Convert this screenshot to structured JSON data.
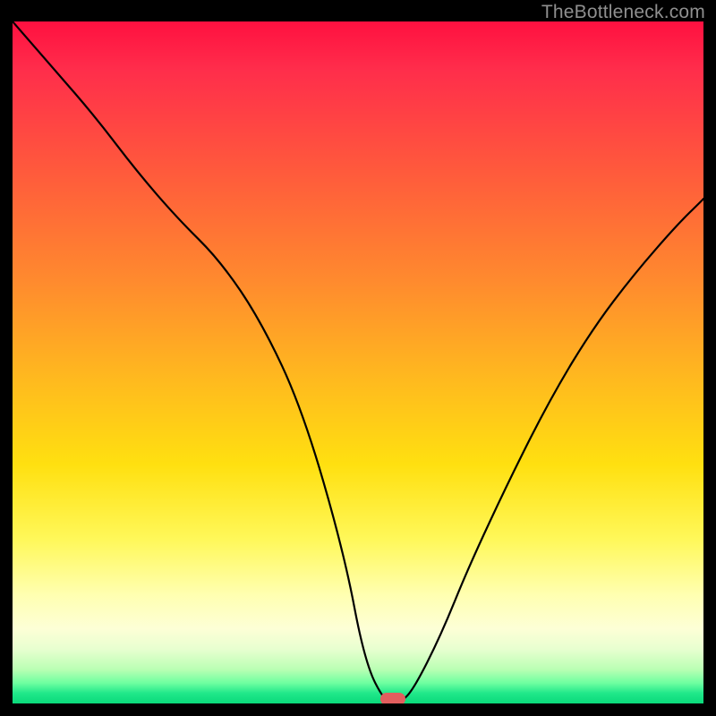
{
  "watermark": {
    "text": "TheBottleneck.com"
  },
  "chart_data": {
    "type": "line",
    "title": "",
    "xlabel": "",
    "ylabel": "",
    "xlim": [
      0,
      100
    ],
    "ylim": [
      0,
      100
    ],
    "grid": false,
    "legend": false,
    "background": {
      "gradient": [
        {
          "stop": 0.0,
          "color": "#ff1040"
        },
        {
          "stop": 0.38,
          "color": "#ff8a2e"
        },
        {
          "stop": 0.65,
          "color": "#ffe010"
        },
        {
          "stop": 0.89,
          "color": "#fdffd6"
        },
        {
          "stop": 1.0,
          "color": "#0ad97a"
        }
      ]
    },
    "series": [
      {
        "name": "bottleneck-curve",
        "x": [
          0,
          6,
          12,
          18,
          24,
          30,
          36,
          42,
          48,
          51,
          54,
          56,
          58,
          62,
          66,
          72,
          78,
          84,
          90,
          96,
          100
        ],
        "y": [
          100,
          93,
          86,
          78,
          71,
          65,
          56,
          43,
          22,
          6,
          0,
          0,
          2,
          10,
          20,
          33,
          45,
          55,
          63,
          70,
          74
        ]
      }
    ],
    "min_marker": {
      "x": 55,
      "y": 0,
      "color": "#e25e5e"
    }
  }
}
